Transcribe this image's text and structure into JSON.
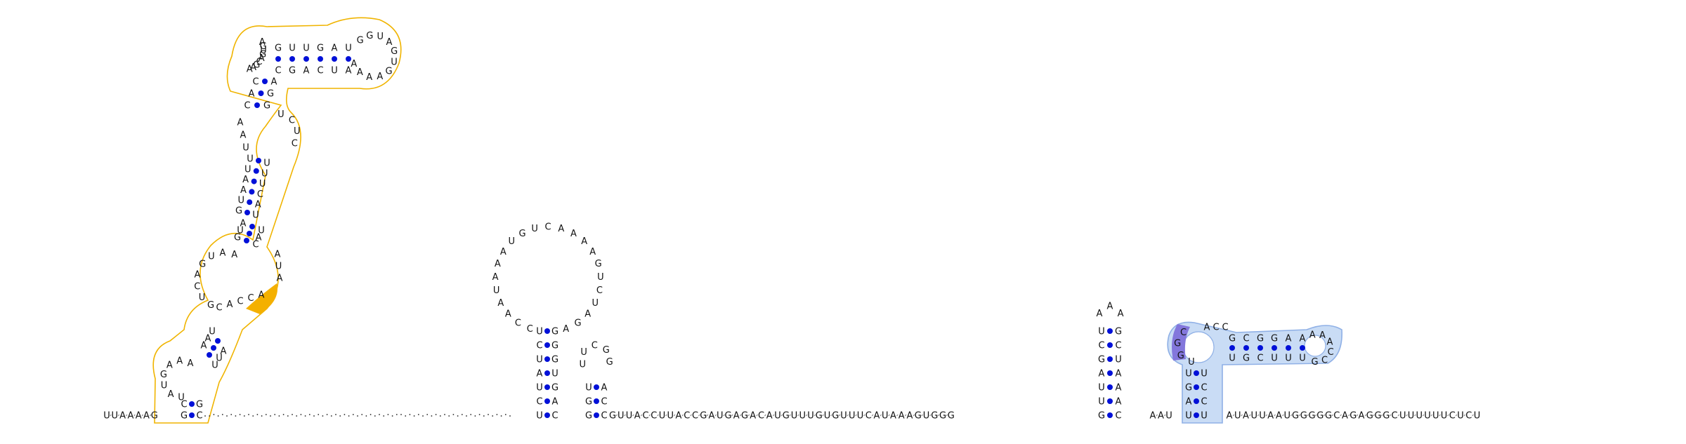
{
  "sequence": {
    "left_tail": "UUAAAAG",
    "hairpin_b_loop": "CCAAUAAAUGUCAAAAGUCUAGA",
    "spacer1": "GUUACCUUACCGAUGAGACAUGUUUGUGUUUCAUAAAGUGGG",
    "hairpin_d_loop": "AAA",
    "spacer2": "AAU",
    "right_tail": "AUAUUAAUGGGGGCAGAGGGCUUUUUUCUCU"
  },
  "colors": {
    "base_text": "#111111",
    "pair_dot": "#0010d8",
    "backbone": "#888888",
    "domain1_stroke": "#f0b400",
    "domain1_highlight": "#f4b000",
    "domain2_fill": "#c9dcf5",
    "domain2_stroke": "#8fb0e6",
    "domain2_highlight": "#8377dc"
  }
}
